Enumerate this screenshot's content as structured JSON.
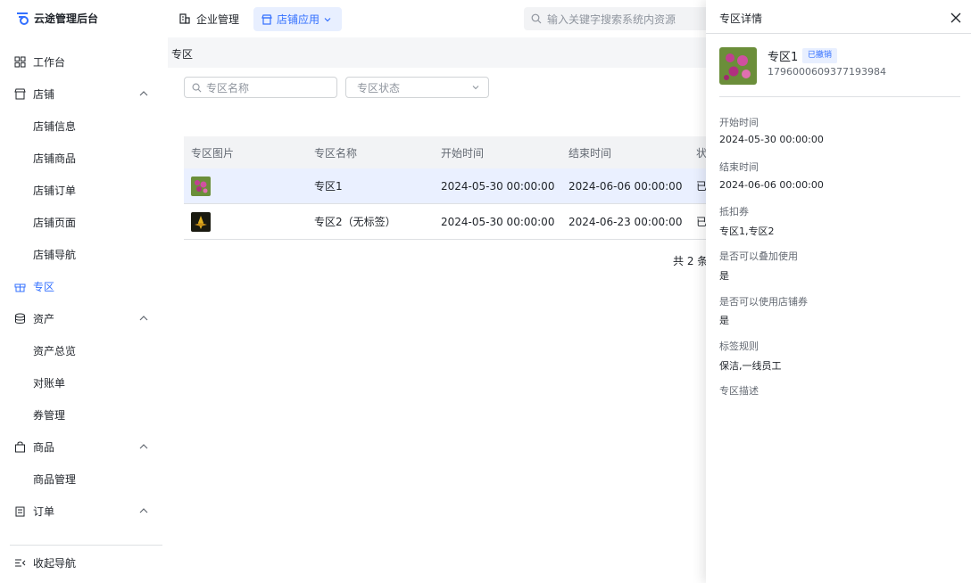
{
  "app": {
    "title": "云途管理后台"
  },
  "topnav": {
    "enterprise": "企业管理",
    "shop_app": "店铺应用",
    "search_placeholder": "输入关键字搜索系统内资源"
  },
  "sidebar": {
    "workbench": "工作台",
    "shop": "店铺",
    "shop_items": [
      "店铺信息",
      "店铺商品",
      "店铺订单",
      "店铺页面",
      "店铺导航"
    ],
    "zone": "专区",
    "assets": "资产",
    "asset_items": [
      "资产总览",
      "对账单",
      "券管理"
    ],
    "goods": "商品",
    "goods_items": [
      "商品管理"
    ],
    "orders": "订单",
    "collapse": "收起导航"
  },
  "main": {
    "breadcrumb": "专区",
    "filter_name_placeholder": "专区名称",
    "filter_status_placeholder": "专区状态",
    "columns": [
      "专区图片",
      "专区名称",
      "开始时间",
      "结束时间",
      "状"
    ],
    "rows": [
      {
        "name": "专区1",
        "start": "2024-05-30 00:00:00",
        "end": "2024-06-06 00:00:00",
        "status": "已"
      },
      {
        "name": "专区2（无标签）",
        "start": "2024-05-30 00:00:00",
        "end": "2024-06-23 00:00:00",
        "status": "已"
      }
    ],
    "total": "共 2 条"
  },
  "drawer": {
    "title": "专区详情",
    "zone_name": "专区1",
    "badge": "已撤销",
    "zone_id": "1796000609377193984",
    "fields": [
      {
        "label": "开始时间",
        "value": "2024-05-30 00:00:00"
      },
      {
        "label": "结束时间",
        "value": "2024-06-06 00:00:00"
      },
      {
        "label": "抵扣券",
        "value": "专区1,专区2"
      },
      {
        "label": "是否可以叠加使用",
        "value": "是"
      },
      {
        "label": "是否可以使用店铺券",
        "value": "是"
      },
      {
        "label": "标签规则",
        "value": "保洁,一线员工"
      },
      {
        "label": "专区描述",
        "value": ""
      }
    ]
  },
  "colors": {
    "primary": "#3370ff",
    "badge_bg": "#e8efff",
    "selected_row": "#eaf0ff"
  }
}
